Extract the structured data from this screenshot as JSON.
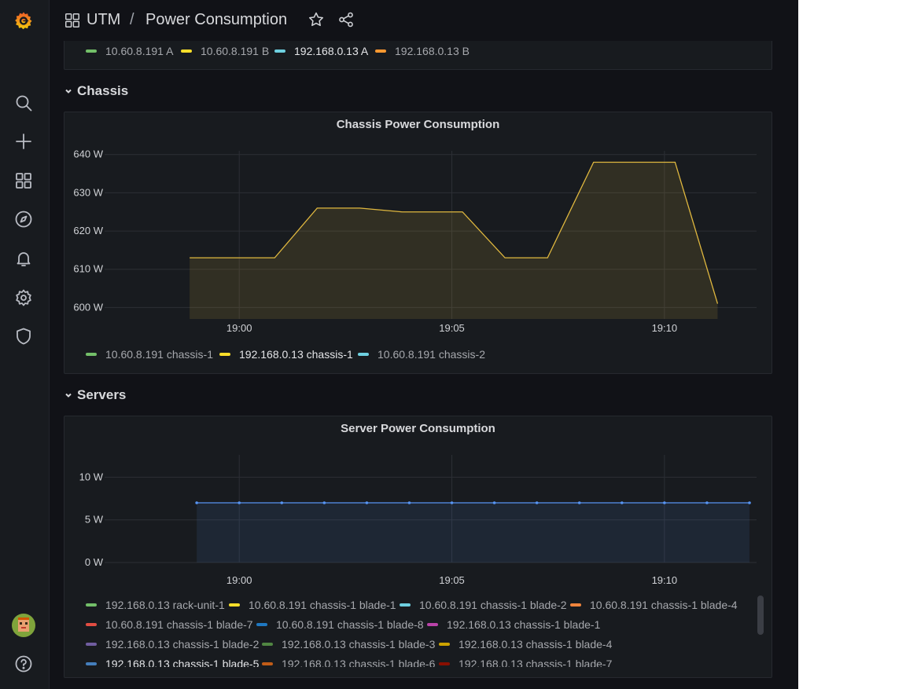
{
  "breadcrumb": {
    "folder": "UTM",
    "separator": "/",
    "title": "Power Consumption"
  },
  "colors": {
    "green": "#73bf69",
    "yellow": "#f2cc0c",
    "lightblue": "#8ab8ff",
    "cyan": "#6ed0e0",
    "orange": "#ff9830",
    "red": "#f2495c",
    "blue": "#5794f2",
    "purple": "#b877d9",
    "darkyellow": "#e0b400",
    "darkred": "#c4162a"
  },
  "top_legend": [
    {
      "label": "10.60.8.191 A",
      "color": "#73bf69"
    },
    {
      "label": "10.60.8.191 B",
      "color": "#fade2a"
    },
    {
      "label": "192.168.0.13 A",
      "color": "#6ed0e0"
    },
    {
      "label": "192.168.0.13 B",
      "color": "#ff9830"
    }
  ],
  "rows": {
    "chassis": "Chassis",
    "servers": "Servers"
  },
  "chassis_panel": {
    "title": "Chassis Power Consumption"
  },
  "chassis_legend": [
    {
      "label": "10.60.8.191 chassis-1",
      "color": "#73bf69"
    },
    {
      "label": "192.168.0.13 chassis-1",
      "color": "#fade2a"
    },
    {
      "label": "10.60.8.191 chassis-2",
      "color": "#6ed0e0"
    }
  ],
  "server_panel": {
    "title": "Server Power Consumption"
  },
  "server_legend": [
    {
      "label": "192.168.0.13 rack-unit-1",
      "color": "#73bf69"
    },
    {
      "label": "10.60.8.191 chassis-1 blade-1",
      "color": "#fade2a"
    },
    {
      "label": "10.60.8.191 chassis-1 blade-2",
      "color": "#6ed0e0"
    },
    {
      "label": "10.60.8.191 chassis-1 blade-4",
      "color": "#ef843c"
    },
    {
      "label": "10.60.8.191 chassis-1 blade-7",
      "color": "#e24d42"
    },
    {
      "label": "10.60.8.191 chassis-1 blade-8",
      "color": "#1f78c1"
    },
    {
      "label": "192.168.0.13 chassis-1 blade-1",
      "color": "#ba43a9"
    },
    {
      "label": "192.168.0.13 chassis-1 blade-2",
      "color": "#705da0"
    },
    {
      "label": "192.168.0.13 chassis-1 blade-3",
      "color": "#508642"
    },
    {
      "label": "192.168.0.13 chassis-1 blade-4",
      "color": "#cca300"
    },
    {
      "label": "192.168.0.13 chassis-1 blade-5",
      "color": "#447ebc"
    },
    {
      "label": "192.168.0.13 chassis-1 blade-6",
      "color": "#c15c17"
    },
    {
      "label": "192.168.0.13 chassis-1 blade-7",
      "color": "#890f02"
    }
  ],
  "chart_data": [
    {
      "type": "area",
      "title": "Chassis Power Consumption",
      "x_tick_labels": [
        "19:00",
        "19:05",
        "19:10"
      ],
      "y_tick_labels": [
        "600 W",
        "610 W",
        "620 W",
        "630 W",
        "640 W"
      ],
      "x_ticks": [
        "19:00",
        "19:05",
        "19:10"
      ],
      "y_ticks": [
        600,
        610,
        620,
        630,
        640
      ],
      "ylim": [
        597,
        642
      ],
      "xlim": [
        "18:56:50",
        "19:12:10"
      ],
      "x_unit": "HH:MM:SS",
      "series": [
        {
          "name": "192.168.0.13 chassis-1",
          "color": "#e0b83f",
          "x": [
            "18:58:50",
            "19:00:50",
            "19:01:50",
            "19:02:50",
            "19:03:50",
            "19:05:15",
            "19:06:15",
            "19:07:15",
            "19:08:20",
            "19:10:15",
            "19:11:15"
          ],
          "y": [
            613,
            613,
            626,
            626,
            625,
            625,
            613,
            613,
            638,
            638,
            601
          ]
        }
      ]
    },
    {
      "type": "line",
      "title": "Server Power Consumption",
      "x_tick_labels": [
        "19:00",
        "19:05",
        "19:10"
      ],
      "y_tick_labels": [
        "0 W",
        "5 W",
        "10 W"
      ],
      "x_ticks": [
        "19:00",
        "19:05",
        "19:10"
      ],
      "y_ticks": [
        0,
        5,
        10
      ],
      "ylim": [
        0,
        14
      ],
      "xlim": [
        "18:56:50",
        "19:12:10"
      ],
      "x_unit": "HH:MM:SS",
      "series": [
        {
          "name": "192.168.0.13 chassis-1 blade-5",
          "color": "#5794f2",
          "x": [
            "18:59:00",
            "19:00:00",
            "19:01:00",
            "19:02:00",
            "19:03:00",
            "19:04:00",
            "19:05:00",
            "19:06:00",
            "19:07:00",
            "19:08:00",
            "19:09:00",
            "19:10:00",
            "19:11:00",
            "19:12:00"
          ],
          "y": [
            7,
            7,
            7,
            7,
            7,
            7,
            7,
            7,
            7,
            7,
            7,
            7,
            7,
            7
          ]
        }
      ]
    }
  ]
}
